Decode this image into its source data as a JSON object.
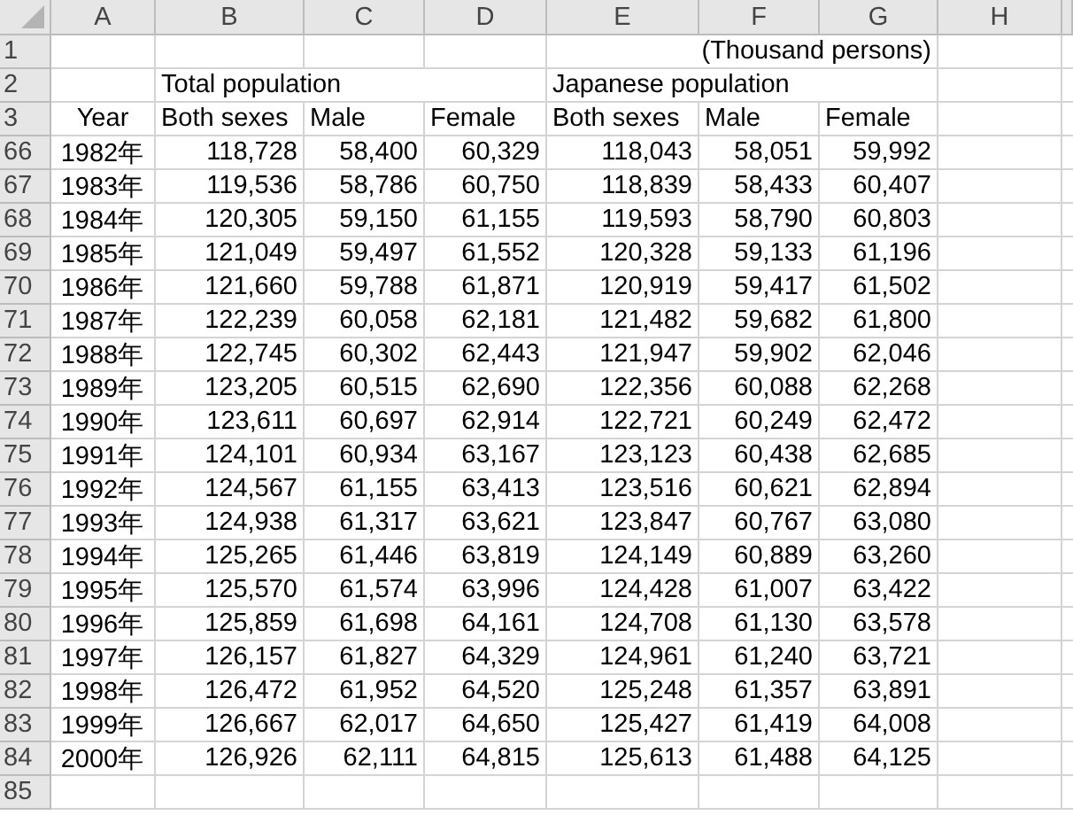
{
  "column_headers": [
    "A",
    "B",
    "C",
    "D",
    "E",
    "F",
    "G",
    "H"
  ],
  "rows": [
    {
      "kind": "unit",
      "number": "1",
      "text": "(Thousand persons)"
    },
    {
      "kind": "groups",
      "number": "2",
      "groups": [
        "Total population",
        "Japanese population"
      ]
    },
    {
      "kind": "labels",
      "number": "3",
      "cells": [
        "Year",
        "Both sexes",
        "Male",
        "Female",
        "Both sexes",
        "Male",
        "Female"
      ]
    },
    {
      "kind": "data",
      "number": "66",
      "cells": [
        "1982年",
        "118,728",
        "58,400",
        "60,329",
        "118,043",
        "58,051",
        "59,992"
      ]
    },
    {
      "kind": "data",
      "number": "67",
      "cells": [
        "1983年",
        "119,536",
        "58,786",
        "60,750",
        "118,839",
        "58,433",
        "60,407"
      ]
    },
    {
      "kind": "data",
      "number": "68",
      "cells": [
        "1984年",
        "120,305",
        "59,150",
        "61,155",
        "119,593",
        "58,790",
        "60,803"
      ]
    },
    {
      "kind": "data",
      "number": "69",
      "cells": [
        "1985年",
        "121,049",
        "59,497",
        "61,552",
        "120,328",
        "59,133",
        "61,196"
      ]
    },
    {
      "kind": "data",
      "number": "70",
      "cells": [
        "1986年",
        "121,660",
        "59,788",
        "61,871",
        "120,919",
        "59,417",
        "61,502"
      ]
    },
    {
      "kind": "data",
      "number": "71",
      "cells": [
        "1987年",
        "122,239",
        "60,058",
        "62,181",
        "121,482",
        "59,682",
        "61,800"
      ]
    },
    {
      "kind": "data",
      "number": "72",
      "cells": [
        "1988年",
        "122,745",
        "60,302",
        "62,443",
        "121,947",
        "59,902",
        "62,046"
      ]
    },
    {
      "kind": "data",
      "number": "73",
      "cells": [
        "1989年",
        "123,205",
        "60,515",
        "62,690",
        "122,356",
        "60,088",
        "62,268"
      ]
    },
    {
      "kind": "data",
      "number": "74",
      "cells": [
        "1990年",
        "123,611",
        "60,697",
        "62,914",
        "122,721",
        "60,249",
        "62,472"
      ]
    },
    {
      "kind": "data",
      "number": "75",
      "cells": [
        "1991年",
        "124,101",
        "60,934",
        "63,167",
        "123,123",
        "60,438",
        "62,685"
      ]
    },
    {
      "kind": "data",
      "number": "76",
      "cells": [
        "1992年",
        "124,567",
        "61,155",
        "63,413",
        "123,516",
        "60,621",
        "62,894"
      ]
    },
    {
      "kind": "data",
      "number": "77",
      "cells": [
        "1993年",
        "124,938",
        "61,317",
        "63,621",
        "123,847",
        "60,767",
        "63,080"
      ]
    },
    {
      "kind": "data",
      "number": "78",
      "cells": [
        "1994年",
        "125,265",
        "61,446",
        "63,819",
        "124,149",
        "60,889",
        "63,260"
      ]
    },
    {
      "kind": "data",
      "number": "79",
      "cells": [
        "1995年",
        "125,570",
        "61,574",
        "63,996",
        "124,428",
        "61,007",
        "63,422"
      ]
    },
    {
      "kind": "data",
      "number": "80",
      "cells": [
        "1996年",
        "125,859",
        "61,698",
        "64,161",
        "124,708",
        "61,130",
        "63,578"
      ]
    },
    {
      "kind": "data",
      "number": "81",
      "cells": [
        "1997年",
        "126,157",
        "61,827",
        "64,329",
        "124,961",
        "61,240",
        "63,721"
      ]
    },
    {
      "kind": "data",
      "number": "82",
      "cells": [
        "1998年",
        "126,472",
        "61,952",
        "64,520",
        "125,248",
        "61,357",
        "63,891"
      ]
    },
    {
      "kind": "data",
      "number": "83",
      "cells": [
        "1999年",
        "126,667",
        "62,017",
        "64,650",
        "125,427",
        "61,419",
        "64,008"
      ]
    },
    {
      "kind": "data",
      "number": "84",
      "cells": [
        "2000年",
        "126,926",
        "62,111",
        "64,815",
        "125,613",
        "61,488",
        "64,125"
      ]
    },
    {
      "kind": "empty",
      "number": "85"
    }
  ]
}
